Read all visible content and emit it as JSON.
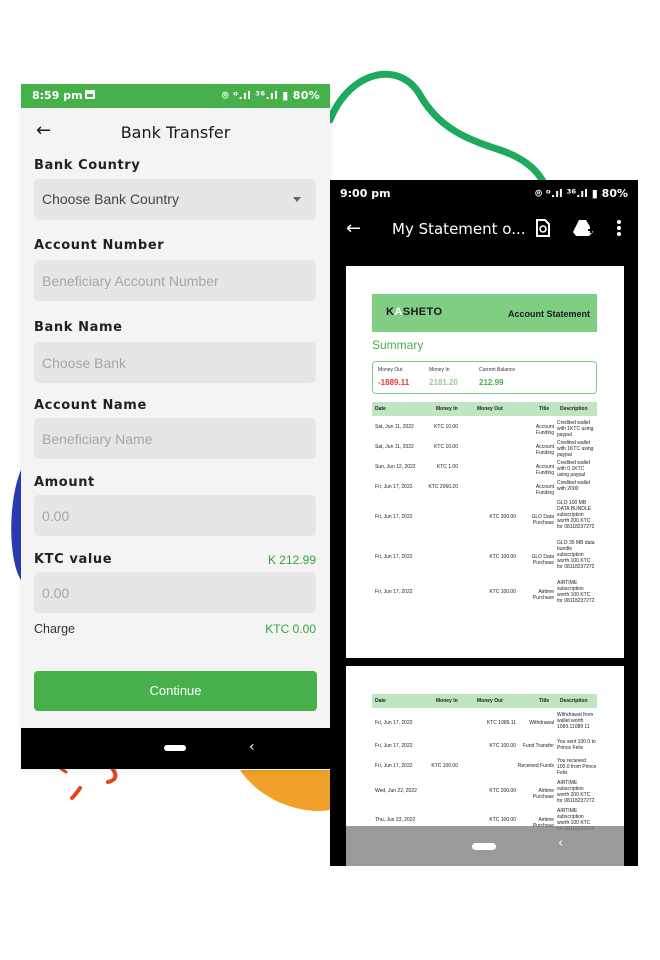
{
  "left_phone": {
    "status_bar": {
      "time": "8:59 pm",
      "indicators": "⌾ ᵒ.ıl ³⁶.ıl ▮ 80%"
    },
    "app_bar": {
      "title": "Bank Transfer"
    },
    "form": {
      "bank_country": {
        "label": "Bank Country",
        "value": "Choose Bank Country"
      },
      "account_number": {
        "label": "Account Number",
        "placeholder": "Beneficiary Account Number"
      },
      "bank_name": {
        "label": "Bank Name",
        "placeholder": "Choose Bank"
      },
      "account_name": {
        "label": "Account Name",
        "placeholder": "Beneficiary Name"
      },
      "amount": {
        "label": "Amount",
        "placeholder": "0.00"
      },
      "ktc_value": {
        "label": "KTC value",
        "placeholder": "0.00",
        "balance": "K 212.99"
      },
      "charge": {
        "label": "Charge",
        "value": "KTC 0.00"
      },
      "continue_label": "Continue"
    }
  },
  "right_phone": {
    "status_bar": {
      "time": "9:00 pm",
      "indicators": "⌾ ᵒ.ıl ³⁶.ıl ▮ 80%"
    },
    "app_bar": {
      "title": "My Statement o..."
    },
    "statement": {
      "logo": "KASHETO",
      "heading": "Account Statement",
      "summary_title": "Summary",
      "summary": {
        "money_out_label": "Money Out",
        "money_out": "-1889.11",
        "money_in_label": "Money In",
        "money_in": "2181.20",
        "balance_label": "Current Balance",
        "balance": "212.99"
      },
      "columns": [
        "Date",
        "Money In",
        "Money Out",
        "Title",
        "Description"
      ],
      "page1_rows": [
        {
          "date": "Sat, Jun 11, 2022",
          "in": "KTC 10.00",
          "out": "",
          "title": "Account Funding",
          "desc": "Credited wallet with 1KTC using paypal"
        },
        {
          "date": "Sat, Jun 11, 2022",
          "in": "KTC 10.00",
          "out": "",
          "title": "Account Funding",
          "desc": "Credited wallet with 1KTC using paypal"
        },
        {
          "date": "Sun, Jun 12, 2022",
          "in": "KTC 1.00",
          "out": "",
          "title": "Account Funding",
          "desc": "Credited wallet with 0.1KTC using paypal"
        },
        {
          "date": "Fri, Jun 17, 2022",
          "in": "KTC 2060.20",
          "out": "",
          "title": "Account Funding",
          "desc": "Credited wallet with 2000"
        },
        {
          "date": "Fri, Jun 17, 2022",
          "in": "",
          "out": "KTC 200.00",
          "title": "GLO Data Purchase",
          "desc": "GLO 100 MB DATA BUNDLE subscription worth 200 KTC for 08118237272"
        },
        {
          "date": "Fri, Jun 17, 2022",
          "in": "",
          "out": "KTC 100.00",
          "title": "GLO Data Purchase",
          "desc": "GLO 35 MB data bundle subscription worth 100 KTC for 08118237272"
        },
        {
          "date": "Fri, Jun 17, 2022",
          "in": "",
          "out": "KTC 100.00",
          "title": "Airtime Purchase",
          "desc": "AIRTIME subscription worth 100 KTC for 08118237272"
        }
      ],
      "page2_rows": [
        {
          "date": "Fri, Jun 17, 2022",
          "in": "",
          "out": "KTC 1089.11",
          "title": "Withdrawal",
          "desc": "Withdrawal from wallet worth 1089.11089 11"
        },
        {
          "date": "Fri, Jun 17, 2022",
          "in": "",
          "out": "KTC 100.00",
          "title": "Fund Transfer",
          "desc": "You sent 100.0 to Prince Felix"
        },
        {
          "date": "Fri, Jun 17, 2022",
          "in": "KTC 100.00",
          "out": "",
          "title": "Received Funds",
          "desc": "You recieved 100.0 from Prince Felix"
        },
        {
          "date": "Wed, Jun 22, 2022",
          "in": "",
          "out": "KTC 200.00",
          "title": "Airtime Purchase",
          "desc": "AIRTIME subscription worth 200 KTC for 08118237272"
        },
        {
          "date": "Thu, Jun 23, 2022",
          "in": "",
          "out": "KTC 100.00",
          "title": "Airtime Purchase",
          "desc": "AIRTIME subscription worth 100 KTC for 08118237272"
        }
      ]
    }
  },
  "colors": {
    "brand_green": "#47b04b",
    "light_green": "#7fce83",
    "money_out_red": "#e53935",
    "blob_blue": "#2a3ab3",
    "blob_orange": "#f0a12a"
  }
}
